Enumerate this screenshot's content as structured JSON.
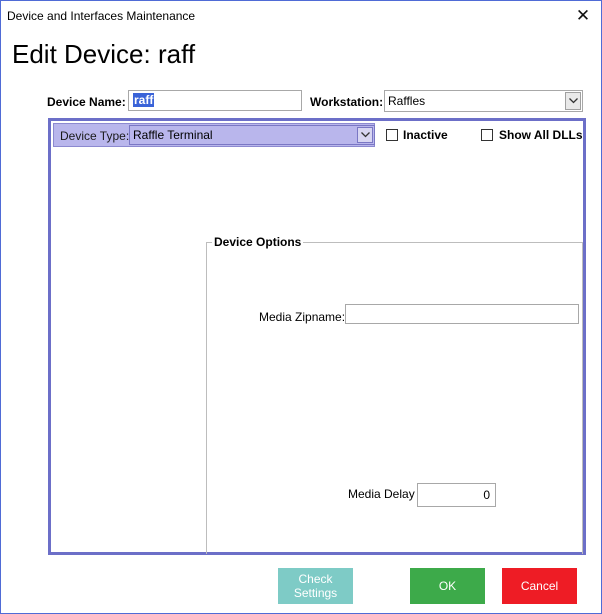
{
  "window": {
    "title": "Device and Interfaces Maintenance",
    "close_glyph": "✕"
  },
  "page": {
    "heading": "Edit Device: raff"
  },
  "form": {
    "device_name_label": "Device Name:",
    "device_name_value": "raff",
    "workstation_label": "Workstation:",
    "workstation_value": "Raffles",
    "device_type_label": "Device Type:",
    "device_type_value": "Raffle Terminal",
    "inactive_label": "Inactive",
    "inactive_checked": false,
    "show_all_dlls_label": "Show All DLLs",
    "show_all_dlls_checked": false
  },
  "device_options": {
    "legend": "Device Options",
    "media_zipname_label": "Media Zipname:",
    "media_zipname_value": "",
    "media_delay_label": "Media Delay",
    "media_delay_value": "0"
  },
  "buttons": {
    "check_settings_line1": "Check",
    "check_settings_line2": "Settings",
    "ok": "OK",
    "cancel": "Cancel"
  },
  "colors": {
    "check_settings_bg": "#7ecbc6",
    "ok_bg": "#3daa4a",
    "cancel_bg": "#ee1c25",
    "panel_border": "#6c6fc8",
    "device_type_highlight": "#b9b6ec",
    "selection": "#3a63d8"
  },
  "icons": {
    "close": "close-icon",
    "dropdown": "chevron-down-icon"
  }
}
